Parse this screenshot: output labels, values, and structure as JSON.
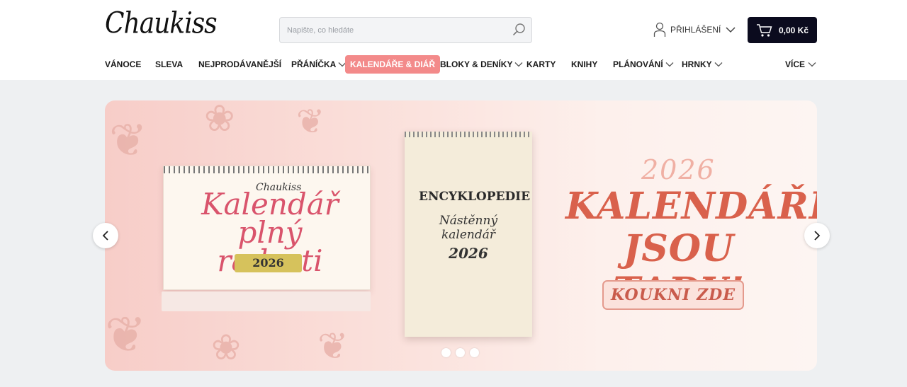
{
  "header": {
    "logo_text": "Chaukiss",
    "search": {
      "placeholder": "Napište, co hledáte",
      "value": "",
      "icon": "search-icon"
    },
    "login": {
      "label": "PŘIHLÁŠENÍ",
      "icon": "user-icon"
    },
    "cart": {
      "label": "0,00 Kč",
      "icon": "cart-icon"
    }
  },
  "nav": {
    "items": [
      {
        "label": "VÁNOCE",
        "dropdown": false
      },
      {
        "label": "SLEVA",
        "dropdown": false
      },
      {
        "label": "NEJPRODÁVANĚJŠÍ",
        "dropdown": false
      },
      {
        "label": "PŘÁNÍČKA",
        "dropdown": true
      },
      {
        "label": "KALENDÁŘE & DIÁŘ",
        "dropdown": false,
        "active": true
      },
      {
        "label": "BLOKY & DENÍKY",
        "dropdown": true
      },
      {
        "label": "KARTY",
        "dropdown": false
      },
      {
        "label": "KNIHY",
        "dropdown": false
      },
      {
        "label": "PLÁNOVÁNÍ",
        "dropdown": true
      },
      {
        "label": "HRNKY",
        "dropdown": true
      }
    ],
    "more": "VÍCE"
  },
  "banner": {
    "desk_calendar": {
      "brand": "Chaukiss",
      "title": "Kalendář plný radosti",
      "year": "2026"
    },
    "wall_calendar": {
      "title": "ENCYKLOPEDIE",
      "subtitle": "Nástěnný kalendář",
      "year": "2026"
    },
    "year": "2026",
    "headline": "KALENDÁŘE JSOU TADY!",
    "cta": "KOUKNI ZDE",
    "slides": 3,
    "active_slide": 1
  },
  "colors": {
    "accent": "#f38a8a",
    "cart_bg": "#0b0b1e",
    "headline": "#d9614c",
    "page_bg": "#eef0f2"
  }
}
